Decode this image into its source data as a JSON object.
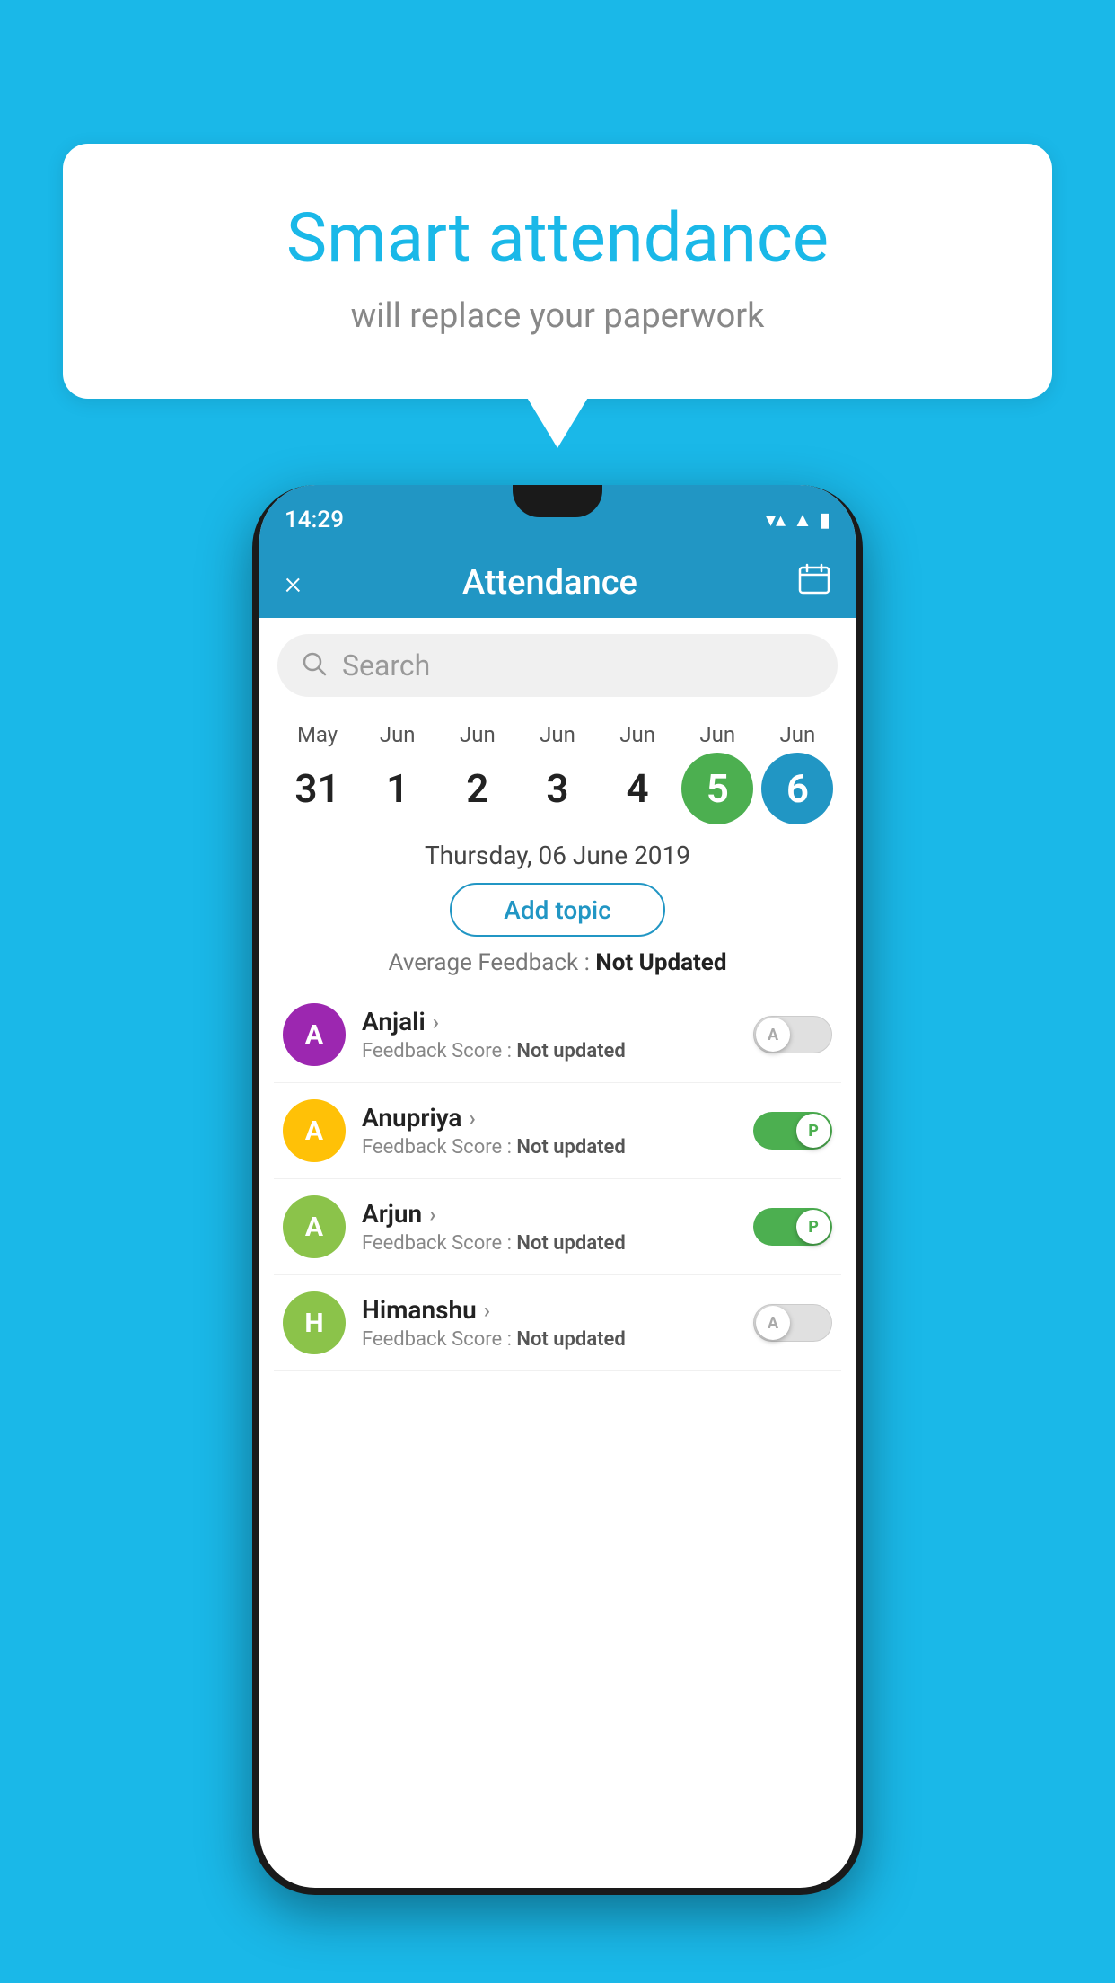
{
  "background_color": "#1ab8e8",
  "speech_bubble": {
    "title": "Smart attendance",
    "subtitle": "will replace your paperwork"
  },
  "app": {
    "status_bar": {
      "time": "14:29"
    },
    "header": {
      "title": "Attendance",
      "close_label": "×",
      "calendar_icon": "📅"
    },
    "search": {
      "placeholder": "Search"
    },
    "dates": [
      {
        "month": "May",
        "day": "31",
        "state": "normal"
      },
      {
        "month": "Jun",
        "day": "1",
        "state": "normal"
      },
      {
        "month": "Jun",
        "day": "2",
        "state": "normal"
      },
      {
        "month": "Jun",
        "day": "3",
        "state": "normal"
      },
      {
        "month": "Jun",
        "day": "4",
        "state": "normal"
      },
      {
        "month": "Jun",
        "day": "5",
        "state": "today"
      },
      {
        "month": "Jun",
        "day": "6",
        "state": "selected"
      }
    ],
    "selected_date": "Thursday, 06 June 2019",
    "add_topic_label": "Add topic",
    "avg_feedback_label": "Average Feedback :",
    "avg_feedback_value": "Not Updated",
    "students": [
      {
        "name": "Anjali",
        "avatar_letter": "A",
        "avatar_color": "#9C27B0",
        "feedback_label": "Feedback Score :",
        "feedback_value": "Not updated",
        "toggle_state": "off",
        "toggle_label": "A"
      },
      {
        "name": "Anupriya",
        "avatar_letter": "A",
        "avatar_color": "#FFC107",
        "feedback_label": "Feedback Score :",
        "feedback_value": "Not updated",
        "toggle_state": "on",
        "toggle_label": "P"
      },
      {
        "name": "Arjun",
        "avatar_letter": "A",
        "avatar_color": "#8BC34A",
        "feedback_label": "Feedback Score :",
        "feedback_value": "Not updated",
        "toggle_state": "on",
        "toggle_label": "P"
      },
      {
        "name": "Himanshu",
        "avatar_letter": "H",
        "avatar_color": "#8BC34A",
        "feedback_label": "Feedback Score :",
        "feedback_value": "Not updated",
        "toggle_state": "off",
        "toggle_label": "A"
      }
    ]
  }
}
